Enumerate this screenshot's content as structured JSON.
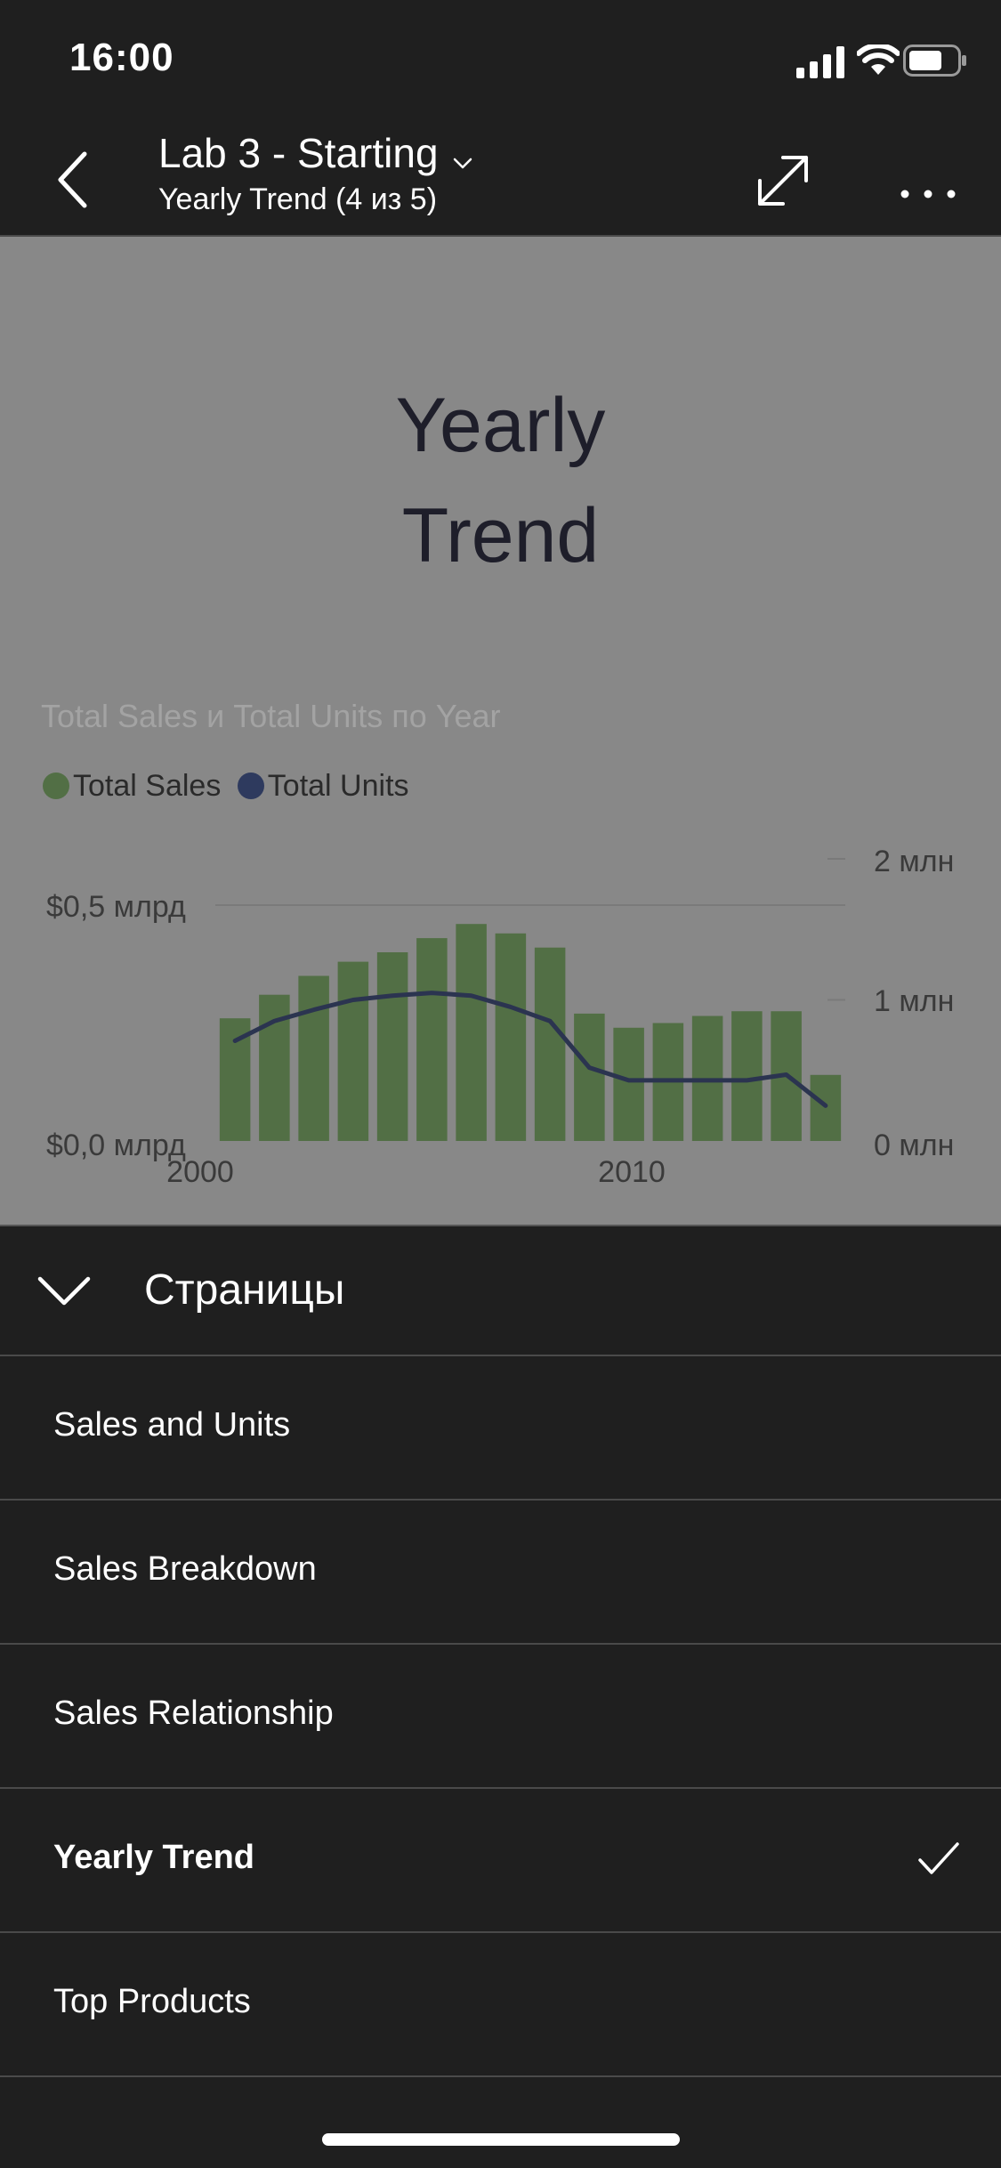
{
  "status_bar": {
    "time": "16:00"
  },
  "nav": {
    "title": "Lab 3 - Starting",
    "subtitle": "Yearly Trend (4 из 5)"
  },
  "report": {
    "heading_line1": "Yearly",
    "heading_line2": "Trend"
  },
  "chart_data": {
    "type": "bar",
    "title": "Total Sales и Total Units по Year",
    "x": [
      2000,
      2001,
      2002,
      2003,
      2004,
      2005,
      2006,
      2007,
      2008,
      2009,
      2010,
      2011,
      2012,
      2013,
      2014,
      2015
    ],
    "x_tick_labels": [
      "2000",
      "2010"
    ],
    "series": [
      {
        "name": "Total Sales",
        "type": "bar",
        "axis": "left",
        "color": "#526f45",
        "values": [
          0.26,
          0.31,
          0.35,
          0.38,
          0.4,
          0.43,
          0.46,
          0.44,
          0.41,
          0.27,
          0.24,
          0.25,
          0.265,
          0.275,
          0.275,
          0.14
        ]
      },
      {
        "name": "Total Units",
        "type": "line",
        "axis": "right",
        "color": "#2b3450",
        "values": [
          0.71,
          0.85,
          0.93,
          1.0,
          1.03,
          1.05,
          1.03,
          0.95,
          0.85,
          0.52,
          0.43,
          0.43,
          0.43,
          0.43,
          0.47,
          0.25
        ]
      }
    ],
    "y_left": {
      "range": [
        0,
        0.5
      ],
      "ticks": [
        0,
        0.5
      ],
      "tick_labels": [
        "$0,0 млрд",
        "$0,5 млрд"
      ]
    },
    "y_right": {
      "range": [
        0,
        2
      ],
      "ticks": [
        0,
        1,
        2
      ],
      "tick_labels": [
        "0 млн",
        "1 млн",
        "2 млн"
      ]
    },
    "grid": true,
    "legend": "top-left"
  },
  "pages": {
    "header_label": "Страницы",
    "items": [
      {
        "label": "Sales and Units",
        "selected": false
      },
      {
        "label": "Sales Breakdown",
        "selected": false
      },
      {
        "label": "Sales Relationship",
        "selected": false
      },
      {
        "label": "Yearly Trend",
        "selected": true
      },
      {
        "label": "Top Products",
        "selected": false
      }
    ]
  },
  "colors": {
    "background": "#1f1f1f",
    "report_canvas": "#888888",
    "sales_bar": "#526f45",
    "units_line": "#2b3450"
  }
}
